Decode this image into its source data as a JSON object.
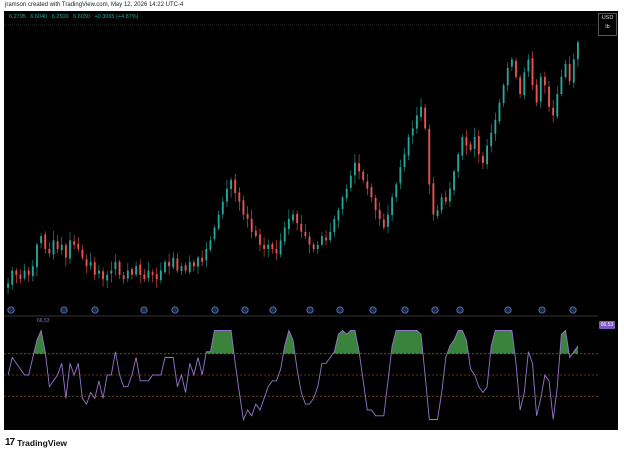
{
  "header": {
    "credit": "jramson created with TradingView.com, May 12, 2026 14:22 UTC-4"
  },
  "legend": {
    "symbol": "",
    "open": "6.2795",
    "high": "6.6040",
    "low": "6.2500",
    "close": "6.6030",
    "change": "+0.3065 (+4.87%)"
  },
  "currency": {
    "code": "USD",
    "unit": "lb"
  },
  "rsi": {
    "label": "66.53",
    "value_badge": "66.53"
  },
  "footer": {
    "logo_mark": "17",
    "brand": "TradingView"
  },
  "colors": {
    "background": "#000000",
    "up": "#26a69a",
    "down": "#ef5350",
    "rsi_line": "#9575cd",
    "rsi_fill": "#4caf50",
    "levels": "#b26a2a"
  },
  "chart_data": [
    {
      "type": "candlestick",
      "title": "",
      "y_scale": "linear",
      "grid": false,
      "last_close_approx": 6.6,
      "price_path_approx": [
        3.8,
        3.95,
        3.9,
        3.85,
        3.95,
        3.9,
        4.0,
        4.25,
        4.35,
        4.2,
        4.15,
        4.3,
        4.2,
        4.25,
        4.1,
        4.3,
        4.25,
        4.2,
        4.1,
        4.0,
        4.05,
        3.9,
        3.95,
        3.85,
        3.9,
        3.95,
        4.05,
        3.9,
        3.85,
        3.95,
        3.9,
        4.0,
        3.9,
        3.85,
        3.95,
        3.9,
        3.85,
        3.95,
        4.05,
        4.0,
        4.1,
        3.95,
        4.0,
        3.95,
        4.05,
        4.0,
        4.1,
        4.05,
        4.2,
        4.3,
        4.45,
        4.6,
        4.75,
        4.9,
        5.0,
        4.85,
        4.75,
        4.6,
        4.55,
        4.4,
        4.35,
        4.25,
        4.2,
        4.25,
        4.2,
        4.15,
        4.3,
        4.45,
        4.55,
        4.6,
        4.5,
        4.4,
        4.35,
        4.25,
        4.2,
        4.25,
        4.35,
        4.3,
        4.4,
        4.55,
        4.65,
        4.8,
        4.9,
        5.05,
        5.2,
        5.1,
        5.0,
        4.9,
        4.8,
        4.65,
        4.55,
        4.45,
        4.6,
        4.8,
        4.95,
        5.15,
        5.3,
        5.5,
        5.6,
        5.75,
        5.85,
        5.6,
        4.95,
        4.6,
        4.65,
        4.8,
        4.75,
        4.9,
        5.1,
        5.3,
        5.5,
        5.4,
        5.35,
        5.5,
        5.3,
        5.2,
        5.4,
        5.55,
        5.7,
        5.9,
        6.1,
        6.3,
        6.4,
        6.2,
        6.0,
        6.25,
        6.4,
        6.1,
        5.9,
        6.2,
        6.1,
        5.85,
        5.75,
        6.0,
        6.2,
        6.35,
        6.15,
        6.4,
        6.6
      ]
    },
    {
      "type": "line",
      "title": "",
      "levels": [
        70,
        50,
        30
      ],
      "ylim": [
        0,
        100
      ]
    }
  ]
}
